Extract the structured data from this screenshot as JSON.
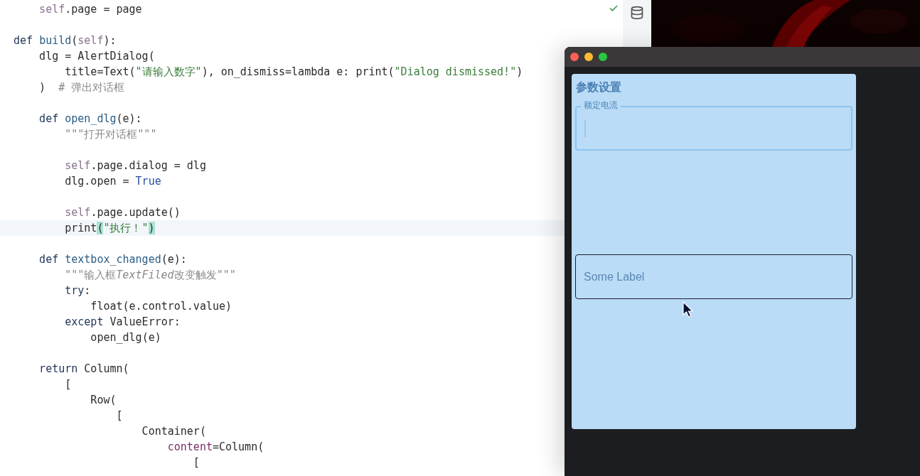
{
  "editor": {
    "lines": [
      {
        "kind": "code",
        "current": false,
        "tokens": [
          {
            "text": "    self",
            "kind": "self"
          },
          {
            "text": ".page = page",
            "kind": "plain"
          }
        ]
      },
      {
        "kind": "blank"
      },
      {
        "kind": "code",
        "current": false,
        "tokens": [
          {
            "text": "def ",
            "kind": "kw"
          },
          {
            "text": "build",
            "kind": "fn"
          },
          {
            "text": "(",
            "kind": "paren"
          },
          {
            "text": "self",
            "kind": "self"
          },
          {
            "text": ")",
            "kind": "paren"
          },
          {
            "text": ":",
            "kind": "plain"
          }
        ]
      },
      {
        "kind": "code",
        "current": false,
        "tokens": [
          {
            "text": "    dlg = AlertDialog",
            "kind": "plain"
          },
          {
            "text": "(",
            "kind": "paren"
          }
        ]
      },
      {
        "kind": "code",
        "current": false,
        "tokens": [
          {
            "text": "        title=Text(",
            "kind": "plain"
          },
          {
            "text": "\"请输入数字\"",
            "kind": "str"
          },
          {
            "text": "), on_dismiss=lambda e: print(",
            "kind": "plain"
          },
          {
            "text": "\"Dialog dismissed!\"",
            "kind": "str"
          },
          {
            "text": ")",
            "kind": "plain"
          }
        ]
      },
      {
        "kind": "code",
        "current": false,
        "tokens": [
          {
            "text": "    )",
            "kind": "paren"
          },
          {
            "text": "  # 弹出对话框",
            "kind": "comment"
          }
        ]
      },
      {
        "kind": "blank"
      },
      {
        "kind": "code",
        "current": false,
        "tokens": [
          {
            "text": "    def ",
            "kind": "kw"
          },
          {
            "text": "open_dlg",
            "kind": "fn"
          },
          {
            "text": "(",
            "kind": "paren"
          },
          {
            "text": "e",
            "kind": "plain"
          },
          {
            "text": ")",
            "kind": "paren"
          },
          {
            "text": ":",
            "kind": "plain"
          }
        ]
      },
      {
        "kind": "code",
        "current": false,
        "tokens": [
          {
            "text": "        \"\"\"打开对话框\"\"\"",
            "kind": "doc"
          }
        ]
      },
      {
        "kind": "blank"
      },
      {
        "kind": "code",
        "current": false,
        "tokens": [
          {
            "text": "        self",
            "kind": "self"
          },
          {
            "text": ".page.dialog = dlg",
            "kind": "plain"
          }
        ]
      },
      {
        "kind": "code",
        "current": false,
        "tokens": [
          {
            "text": "        dlg.open = ",
            "kind": "plain"
          },
          {
            "text": "True",
            "kind": "const"
          }
        ]
      },
      {
        "kind": "blank"
      },
      {
        "kind": "code",
        "current": false,
        "tokens": [
          {
            "text": "        self",
            "kind": "self"
          },
          {
            "text": ".page.update",
            "kind": "plain"
          },
          {
            "text": "()",
            "kind": "paren"
          }
        ]
      },
      {
        "kind": "code",
        "current": true,
        "tokens": [
          {
            "text": "        print",
            "kind": "plain"
          },
          {
            "text": "(",
            "kind": "match"
          },
          {
            "text": "\"执行！\"",
            "kind": "str"
          },
          {
            "text": ")",
            "kind": "match"
          }
        ]
      },
      {
        "kind": "blank"
      },
      {
        "kind": "code",
        "current": false,
        "tokens": [
          {
            "text": "    def ",
            "kind": "kw"
          },
          {
            "text": "textbox_changed",
            "kind": "fn"
          },
          {
            "text": "(",
            "kind": "paren"
          },
          {
            "text": "e",
            "kind": "plain"
          },
          {
            "text": ")",
            "kind": "paren"
          },
          {
            "text": ":",
            "kind": "plain"
          }
        ]
      },
      {
        "kind": "code",
        "current": false,
        "tokens": [
          {
            "text": "        \"\"\"输入框",
            "kind": "doc"
          },
          {
            "text": "TextFiled",
            "kind": "doc_italic"
          },
          {
            "text": "改变触发\"\"\"",
            "kind": "doc"
          }
        ]
      },
      {
        "kind": "code",
        "current": false,
        "tokens": [
          {
            "text": "        try",
            "kind": "kw"
          },
          {
            "text": ":",
            "kind": "plain"
          }
        ]
      },
      {
        "kind": "code",
        "current": false,
        "tokens": [
          {
            "text": "            float",
            "kind": "plain"
          },
          {
            "text": "(",
            "kind": "paren"
          },
          {
            "text": "e.control.value",
            "kind": "plain"
          },
          {
            "text": ")",
            "kind": "paren"
          }
        ]
      },
      {
        "kind": "code",
        "current": false,
        "tokens": [
          {
            "text": "        except ",
            "kind": "kw"
          },
          {
            "text": "ValueError:",
            "kind": "plain"
          }
        ]
      },
      {
        "kind": "code",
        "current": false,
        "tokens": [
          {
            "text": "            open_dlg",
            "kind": "plain"
          },
          {
            "text": "(",
            "kind": "paren"
          },
          {
            "text": "e",
            "kind": "plain"
          },
          {
            "text": ")",
            "kind": "paren"
          }
        ]
      },
      {
        "kind": "blank"
      },
      {
        "kind": "code",
        "current": false,
        "tokens": [
          {
            "text": "    return ",
            "kind": "kw"
          },
          {
            "text": "Column",
            "kind": "plain"
          },
          {
            "text": "(",
            "kind": "paren"
          }
        ]
      },
      {
        "kind": "code",
        "current": false,
        "tokens": [
          {
            "text": "        [",
            "kind": "paren"
          }
        ]
      },
      {
        "kind": "code",
        "current": false,
        "tokens": [
          {
            "text": "            Row(",
            "kind": "plain"
          }
        ]
      },
      {
        "kind": "code",
        "current": false,
        "tokens": [
          {
            "text": "                [",
            "kind": "plain"
          }
        ]
      },
      {
        "kind": "code",
        "current": false,
        "tokens": [
          {
            "text": "                    Container",
            "kind": "plain"
          },
          {
            "text": "(",
            "kind": "paren"
          }
        ]
      },
      {
        "kind": "code",
        "current": false,
        "tokens": [
          {
            "text": "                        content",
            "kind": "param"
          },
          {
            "text": "=Column(",
            "kind": "plain"
          }
        ]
      },
      {
        "kind": "code",
        "current": false,
        "tokens": [
          {
            "text": "                            [",
            "kind": "paren"
          }
        ]
      }
    ]
  },
  "app": {
    "title": "参数设置",
    "fields": [
      {
        "label": "额定电流",
        "focused": true
      },
      {
        "placeholder": "Some Label",
        "focused": false
      }
    ]
  }
}
